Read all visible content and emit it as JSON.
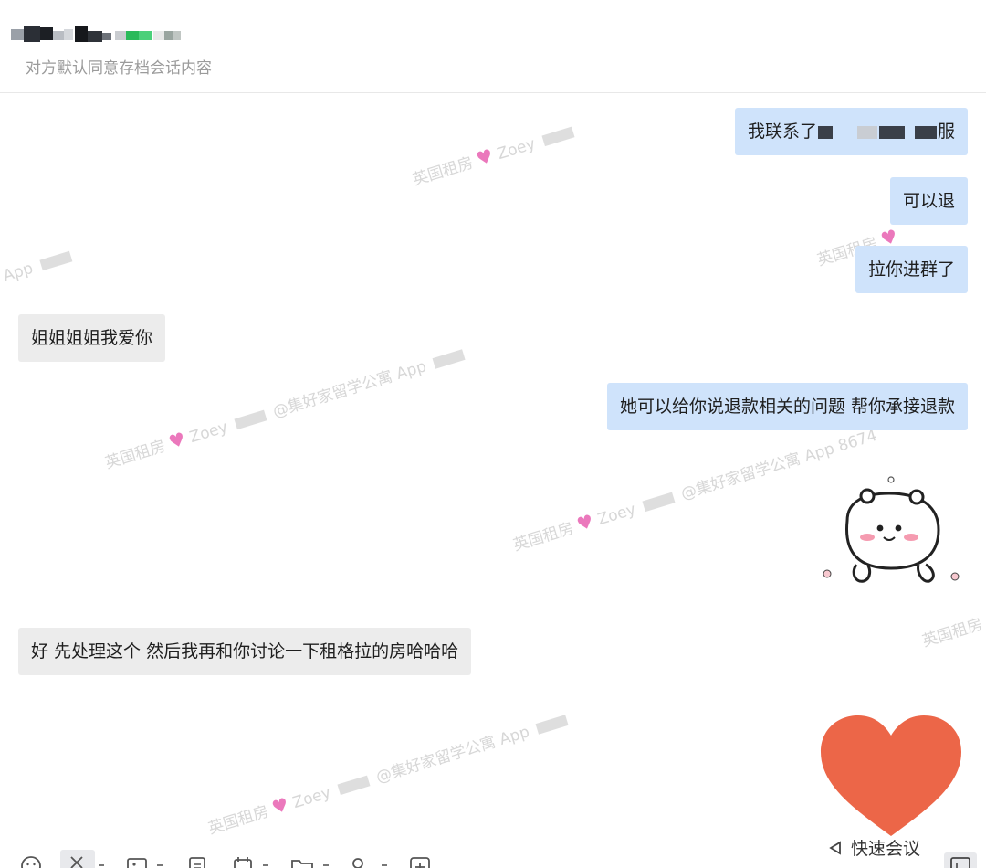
{
  "header": {
    "subtitle": "对方默认同意存档会话内容"
  },
  "messages": [
    {
      "direction": "out",
      "text_before": "我联系了",
      "text_after": "服"
    },
    {
      "direction": "out",
      "text": "可以退"
    },
    {
      "direction": "out",
      "text": "拉你进群了"
    },
    {
      "direction": "in",
      "text": "姐姐姐姐我爱你"
    },
    {
      "direction": "out",
      "text": "她可以给你说退款相关的问题 帮你承接退款"
    },
    {
      "direction": "in",
      "text": "好 先处理这个 然后我再和你讨论一下租格拉的房哈哈哈"
    }
  ],
  "watermark": {
    "prefix": "英国租房",
    "user": "Zoey",
    "company": "@集好家留学公寓",
    "app": "App",
    "code": "8674"
  },
  "stickers": {
    "sticker_1": "bear-face-sticker",
    "sticker_2": "red-heart-sticker"
  },
  "toolbar": {
    "quick_meeting_label": "快速会议",
    "icons": [
      "emoji-icon",
      "screenshot-icon",
      "image-icon",
      "document-icon",
      "calendar-icon",
      "folder-icon",
      "location-icon",
      "plus-icon",
      "panel-icon"
    ]
  },
  "colors": {
    "outgoing_bubble": "#cfe3fb",
    "incoming_bubble": "#ececec",
    "heart": "#ec6648"
  }
}
